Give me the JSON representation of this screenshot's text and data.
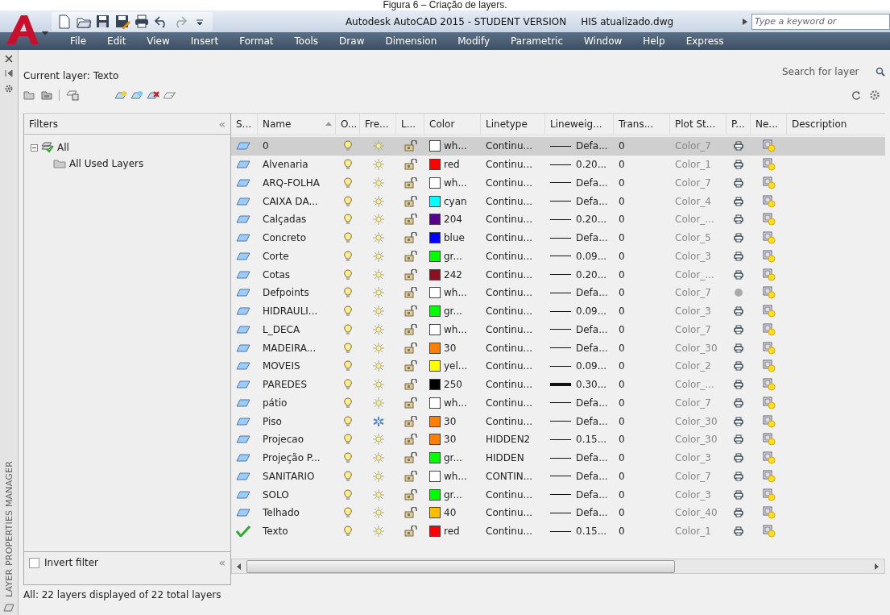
{
  "caption": "Figura 6 – Criação de layers.",
  "title_bar": {
    "title": "Autodesk AutoCAD 2015 - STUDENT VERSION",
    "file": "HIS atualizado.dwg",
    "search": {
      "placeholder": "Type a keyword or"
    }
  },
  "menu": [
    "File",
    "Edit",
    "View",
    "Insert",
    "Format",
    "Tools",
    "Draw",
    "Dimension",
    "Modify",
    "Parametric",
    "Window",
    "Help",
    "Express"
  ],
  "palette": {
    "title": "LAYER PROPERTIES MANAGER",
    "current_layer": "Current layer: Texto",
    "search": {
      "placeholder": "Search for layer"
    },
    "filters": {
      "header": "Filters",
      "collapse": "«",
      "tree": [
        {
          "label": "All",
          "expanded": true,
          "children": [
            {
              "label": "All Used Layers"
            }
          ]
        }
      ],
      "invert_filter": {
        "label": "Invert filter",
        "checked": false
      },
      "collapse_bottom": "«"
    },
    "table": {
      "columns": [
        {
          "label": "S...",
          "sorted": false
        },
        {
          "label": "Name",
          "sorted": true
        },
        {
          "label": "O...",
          "sorted": false
        },
        {
          "label": "Fre...",
          "sorted": false
        },
        {
          "label": "L...",
          "sorted": false
        },
        {
          "label": "Color",
          "sorted": false
        },
        {
          "label": "Linetype",
          "sorted": false
        },
        {
          "label": "Lineweig...",
          "sorted": false
        },
        {
          "label": "Trans...",
          "sorted": false
        },
        {
          "label": "Plot St...",
          "sorted": false
        },
        {
          "label": "P...",
          "sorted": false
        },
        {
          "label": "Ne...",
          "sorted": false
        },
        {
          "label": "Description",
          "sorted": false
        }
      ],
      "rows": [
        {
          "kind": "layer",
          "name": "0",
          "on": true,
          "frozen": false,
          "locked": false,
          "color": "#ffffff",
          "color_name": "wh...",
          "linetype": "Continu...",
          "heavy": false,
          "lineweight": "Defa...",
          "transparency": "0",
          "plot_style": "Color_7",
          "plot": true,
          "selected": true
        },
        {
          "kind": "layer",
          "name": "Alvenaria",
          "on": true,
          "frozen": false,
          "locked": false,
          "color": "#ff0000",
          "color_name": "red",
          "linetype": "Continu...",
          "heavy": false,
          "lineweight": "0.20...",
          "transparency": "0",
          "plot_style": "Color_1",
          "plot": true,
          "selected": false
        },
        {
          "kind": "layer",
          "name": "ARQ-FOLHA",
          "on": true,
          "frozen": false,
          "locked": false,
          "color": "#ffffff",
          "color_name": "wh...",
          "linetype": "Continu...",
          "heavy": false,
          "lineweight": "Defa...",
          "transparency": "0",
          "plot_style": "Color_7",
          "plot": true,
          "selected": false
        },
        {
          "kind": "layer",
          "name": "CAIXA DA...",
          "on": true,
          "frozen": false,
          "locked": false,
          "color": "#00ffff",
          "color_name": "cyan",
          "linetype": "Continu...",
          "heavy": false,
          "lineweight": "Defa...",
          "transparency": "0",
          "plot_style": "Color_4",
          "plot": true,
          "selected": false
        },
        {
          "kind": "layer",
          "name": "Calçadas",
          "on": true,
          "frozen": false,
          "locked": false,
          "color": "#5a0090",
          "color_name": "204",
          "linetype": "Continu...",
          "heavy": false,
          "lineweight": "0.20...",
          "transparency": "0",
          "plot_style": "Color_...",
          "plot": true,
          "selected": false
        },
        {
          "kind": "layer",
          "name": "Concreto",
          "on": true,
          "frozen": false,
          "locked": false,
          "color": "#0000ff",
          "color_name": "blue",
          "linetype": "Continu...",
          "heavy": false,
          "lineweight": "Defa...",
          "transparency": "0",
          "plot_style": "Color_5",
          "plot": true,
          "selected": false
        },
        {
          "kind": "layer",
          "name": "Corte",
          "on": true,
          "frozen": false,
          "locked": false,
          "color": "#00ff00",
          "color_name": "gr...",
          "linetype": "Continu...",
          "heavy": false,
          "lineweight": "0.09...",
          "transparency": "0",
          "plot_style": "Color_3",
          "plot": true,
          "selected": false
        },
        {
          "kind": "layer",
          "name": "Cotas",
          "on": true,
          "frozen": false,
          "locked": false,
          "color": "#8b1020",
          "color_name": "242",
          "linetype": "Continu...",
          "heavy": false,
          "lineweight": "0.20...",
          "transparency": "0",
          "plot_style": "Color_...",
          "plot": true,
          "selected": false
        },
        {
          "kind": "layer",
          "name": "Defpoints",
          "on": true,
          "frozen": false,
          "locked": false,
          "color": "#ffffff",
          "color_name": "wh...",
          "linetype": "Continu...",
          "heavy": false,
          "lineweight": "Defa...",
          "transparency": "0",
          "plot_style": "Color_7",
          "plot": false,
          "selected": false
        },
        {
          "kind": "layer",
          "name": "HIDRAULI...",
          "on": true,
          "frozen": false,
          "locked": false,
          "color": "#00ff00",
          "color_name": "gr...",
          "linetype": "Continu...",
          "heavy": false,
          "lineweight": "0.09...",
          "transparency": "0",
          "plot_style": "Color_3",
          "plot": true,
          "selected": false
        },
        {
          "kind": "layer",
          "name": "L_DECA",
          "on": true,
          "frozen": false,
          "locked": false,
          "color": "#ffffff",
          "color_name": "wh...",
          "linetype": "Continu...",
          "heavy": false,
          "lineweight": "Defa...",
          "transparency": "0",
          "plot_style": "Color_7",
          "plot": true,
          "selected": false
        },
        {
          "kind": "layer",
          "name": "MADEIRA...",
          "on": true,
          "frozen": false,
          "locked": false,
          "color": "#ff7f00",
          "color_name": "30",
          "linetype": "Continu...",
          "heavy": false,
          "lineweight": "Defa...",
          "transparency": "0",
          "plot_style": "Color_30",
          "plot": true,
          "selected": false
        },
        {
          "kind": "layer",
          "name": "MOVEIS",
          "on": true,
          "frozen": false,
          "locked": false,
          "color": "#ffff00",
          "color_name": "yel...",
          "linetype": "Continu...",
          "heavy": false,
          "lineweight": "0.09...",
          "transparency": "0",
          "plot_style": "Color_2",
          "plot": true,
          "selected": false
        },
        {
          "kind": "layer",
          "name": "PAREDES",
          "on": true,
          "frozen": false,
          "locked": false,
          "color": "#000000",
          "color_name": "250",
          "linetype": "Continu...",
          "heavy": true,
          "lineweight": "0.30...",
          "transparency": "0",
          "plot_style": "Color_...",
          "plot": true,
          "selected": false
        },
        {
          "kind": "layer",
          "name": "pátio",
          "on": true,
          "frozen": false,
          "locked": false,
          "color": "#ffffff",
          "color_name": "wh...",
          "linetype": "Continu...",
          "heavy": false,
          "lineweight": "Defa...",
          "transparency": "0",
          "plot_style": "Color_7",
          "plot": true,
          "selected": false
        },
        {
          "kind": "layer",
          "name": "Piso",
          "on": true,
          "frozen": true,
          "locked": false,
          "color": "#ff7f00",
          "color_name": "30",
          "linetype": "Continu...",
          "heavy": false,
          "lineweight": "Defa...",
          "transparency": "0",
          "plot_style": "Color_30",
          "plot": true,
          "selected": false
        },
        {
          "kind": "layer",
          "name": "Projecao",
          "on": true,
          "frozen": false,
          "locked": false,
          "color": "#ff7f00",
          "color_name": "30",
          "linetype": "HIDDEN2",
          "heavy": false,
          "lineweight": "0.15...",
          "transparency": "0",
          "plot_style": "Color_30",
          "plot": true,
          "selected": false
        },
        {
          "kind": "layer",
          "name": "Projeção P...",
          "on": true,
          "frozen": false,
          "locked": false,
          "color": "#00ff00",
          "color_name": "gr...",
          "linetype": "HIDDEN",
          "heavy": false,
          "lineweight": "Defa...",
          "transparency": "0",
          "plot_style": "Color_3",
          "plot": true,
          "selected": false
        },
        {
          "kind": "layer",
          "name": "SANITARIO",
          "on": true,
          "frozen": false,
          "locked": false,
          "color": "#ffffff",
          "color_name": "wh...",
          "linetype": "CONTIN...",
          "heavy": false,
          "lineweight": "Defa...",
          "transparency": "0",
          "plot_style": "Color_7",
          "plot": true,
          "selected": false
        },
        {
          "kind": "layer",
          "name": "SOLO",
          "on": true,
          "frozen": false,
          "locked": false,
          "color": "#00ff00",
          "color_name": "gr...",
          "linetype": "Continu...",
          "heavy": false,
          "lineweight": "Defa...",
          "transparency": "0",
          "plot_style": "Color_3",
          "plot": true,
          "selected": false
        },
        {
          "kind": "layer",
          "name": "Telhado",
          "on": true,
          "frozen": false,
          "locked": false,
          "color": "#ffbf00",
          "color_name": "40",
          "linetype": "Continu...",
          "heavy": false,
          "lineweight": "Defa...",
          "transparency": "0",
          "plot_style": "Color_40",
          "plot": true,
          "selected": false
        },
        {
          "kind": "current",
          "name": "Texto",
          "on": true,
          "frozen": false,
          "locked": false,
          "color": "#ff0000",
          "color_name": "red",
          "linetype": "Continu...",
          "heavy": false,
          "lineweight": "0.15...",
          "transparency": "0",
          "plot_style": "Color_1",
          "plot": true,
          "selected": false
        }
      ]
    },
    "status": "All: 22 layers displayed of 22 total layers"
  }
}
